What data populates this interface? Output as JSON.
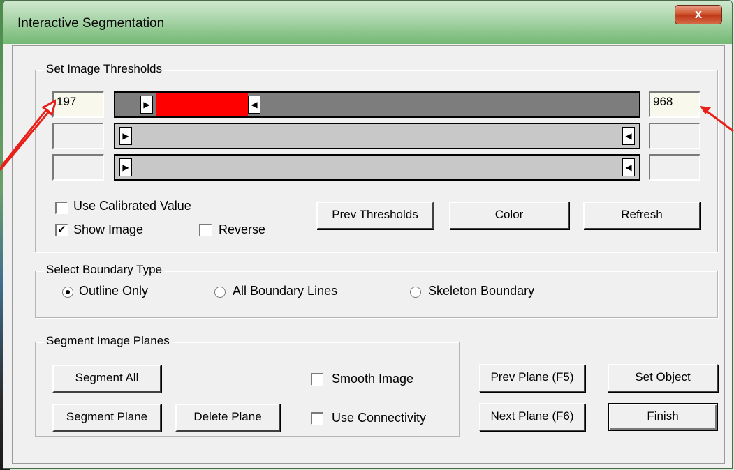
{
  "window": {
    "title": "Interactive Segmentation",
    "close_label": "x"
  },
  "thresholds": {
    "group_title": "Set Image Thresholds",
    "rows": [
      {
        "min_value": "197",
        "max_value": "968",
        "range": [
          0.07,
          0.25
        ],
        "fill_color": "#ff0000"
      },
      {
        "min_value": "",
        "max_value": "",
        "range": [
          0.0,
          1.0
        ],
        "fill_color": "#c8c8c8"
      },
      {
        "min_value": "",
        "max_value": "",
        "range": [
          0.0,
          1.0
        ],
        "fill_color": "#c8c8c8"
      }
    ],
    "use_calibrated_label": "Use Calibrated Value",
    "use_calibrated_checked": false,
    "show_image_label": "Show Image",
    "show_image_checked": true,
    "reverse_label": "Reverse",
    "reverse_checked": false,
    "prev_thresholds_label": "Prev Thresholds",
    "color_label": "Color",
    "refresh_label": "Refresh"
  },
  "boundary": {
    "group_title": "Select Boundary Type",
    "options": [
      "Outline Only",
      "All Boundary Lines",
      "Skeleton Boundary"
    ],
    "selected": "Outline Only"
  },
  "planes": {
    "group_title": "Segment Image Planes",
    "segment_all_label": "Segment All",
    "segment_plane_label": "Segment Plane",
    "delete_plane_label": "Delete Plane",
    "smooth_label": "Smooth Image",
    "smooth_checked": false,
    "connectivity_label": "Use Connectivity",
    "connectivity_checked": false
  },
  "actions": {
    "prev_plane_label": "Prev Plane (F5)",
    "next_plane_label": "Next Plane (F6)",
    "set_object_label": "Set Object",
    "finish_label": "Finish"
  },
  "colors": {
    "accent_arrow": "#e8201a",
    "title_green": "#8fc78f"
  },
  "icons": [
    "close-icon",
    "arrow-right-icon",
    "arrow-left-icon",
    "check-icon",
    "radio-dot-icon",
    "annotation-arrow-icon"
  ]
}
